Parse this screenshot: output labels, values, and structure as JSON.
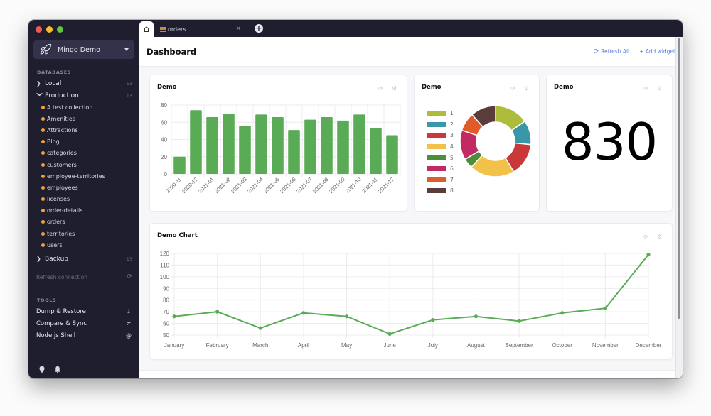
{
  "app": {
    "connection_name": "Mingo Demo",
    "sections": {
      "databases": "DATABASES",
      "tools": "TOOLS"
    }
  },
  "sidebar": {
    "databases": [
      {
        "name": "Local",
        "count": "13",
        "expanded": false
      },
      {
        "name": "Production",
        "count": "13",
        "expanded": true
      },
      {
        "name": "Backup",
        "count": "13",
        "expanded": false
      }
    ],
    "collections": [
      "A test collection",
      "Amenities",
      "Attractions",
      "Blog",
      "categories",
      "customers",
      "employee-territories",
      "employees",
      "licenses",
      "order-details",
      "orders",
      "territories",
      "users"
    ],
    "collection_dot_color": "#f0a03c",
    "refresh_connection": "Refresh connection",
    "tools": [
      {
        "label": "Dump & Restore",
        "icon": "download-icon"
      },
      {
        "label": "Compare & Sync",
        "icon": "not-equal-icon"
      },
      {
        "label": "Node.js Shell",
        "icon": "at-icon"
      }
    ]
  },
  "tabs": [
    {
      "type": "home",
      "icon": "home-icon",
      "active": true
    },
    {
      "label": "orders",
      "icon": "collection-icon",
      "active": false
    }
  ],
  "header": {
    "title": "Dashboard",
    "refresh_all": "Refresh All",
    "add_widget": "+ Add widget"
  },
  "widgets": {
    "bar": {
      "title": "Demo"
    },
    "donut": {
      "title": "Demo"
    },
    "number": {
      "title": "Demo",
      "value": "830"
    },
    "line": {
      "title": "Demo Chart"
    }
  },
  "chart_data": [
    {
      "type": "bar",
      "title": "Demo",
      "categories": [
        "2020-11",
        "2020-12",
        "2021-01",
        "2021-02",
        "2021-03",
        "2021-04",
        "2021-05",
        "2021-06",
        "2021-07",
        "2021-08",
        "2021-09",
        "2021-10",
        "2021-11",
        "2021-12"
      ],
      "values": [
        20,
        74,
        66,
        70,
        56,
        69,
        66,
        51,
        63,
        66,
        62,
        69,
        53,
        45
      ],
      "yticks": [
        0,
        20,
        40,
        60,
        80
      ],
      "ylim": [
        0,
        80
      ],
      "color": "#5aab55",
      "grid": true
    },
    {
      "type": "pie",
      "donut": true,
      "title": "Demo",
      "labels": [
        "1",
        "2",
        "3",
        "4",
        "5",
        "6",
        "7",
        "8"
      ],
      "values": [
        15.5,
        11,
        15,
        20.5,
        4.5,
        13.5,
        8.5,
        11.5
      ],
      "colors": [
        "#aebc3c",
        "#3a97a9",
        "#c9393a",
        "#f2c14a",
        "#4d8e3d",
        "#c12a63",
        "#e05b2a",
        "#5a3d3a"
      ],
      "legend": "left"
    },
    {
      "type": "line",
      "title": "Demo Chart",
      "categories": [
        "January",
        "February",
        "March",
        "April",
        "May",
        "June",
        "July",
        "August",
        "September",
        "October",
        "November",
        "December"
      ],
      "values": [
        66,
        70,
        56,
        69,
        66,
        51,
        63,
        66,
        62,
        69,
        73,
        119
      ],
      "yticks": [
        50,
        60,
        70,
        80,
        90,
        100,
        110,
        120
      ],
      "ylim": [
        50,
        120
      ],
      "color": "#5aab55",
      "grid": true
    }
  ]
}
